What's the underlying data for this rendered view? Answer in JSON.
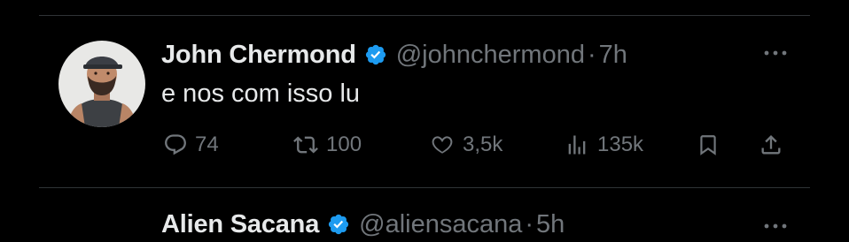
{
  "tweet": {
    "display_name": "John Chermond",
    "handle": "@johnchermond",
    "separator": "·",
    "time": "7h",
    "text": "e nos com isso lu",
    "verified": true,
    "actions": {
      "replies": "74",
      "retweets": "100",
      "likes": "3,5k",
      "views": "135k"
    }
  },
  "next_tweet": {
    "display_name": "Alien Sacana",
    "handle": "@aliensacana",
    "separator": "·",
    "time": "5h",
    "verified": true
  },
  "colors": {
    "background": "#000000",
    "text_primary": "#e7e9ea",
    "text_secondary": "#71767b",
    "verified_blue": "#1d9bf0",
    "divider": "#2f3336"
  },
  "icons": {
    "reply": "reply-icon",
    "retweet": "retweet-icon",
    "like": "heart-icon",
    "views": "views-chart-icon",
    "bookmark": "bookmark-icon",
    "share": "share-icon",
    "more": "more-dots-icon",
    "verified": "verified-badge-icon"
  }
}
